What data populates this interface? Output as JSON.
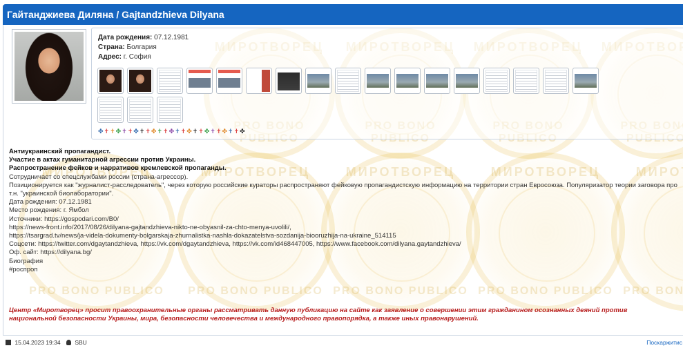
{
  "header": {
    "title": "Гайтанджиева Диляна / Gajtandzhieva Dilyana"
  },
  "profile": {
    "birth_label": "Дата рождения:",
    "birth_value": "07.12.1981",
    "country_label": "Страна:",
    "country_value": "Болгария",
    "address_label": "Адрес:",
    "address_value": "г. София"
  },
  "watermark": {
    "top_text": "МИРОТВОРЕЦ",
    "bottom_text": "PRO BONO PUBLICO"
  },
  "thumbnails": [
    "photo",
    "photo",
    "doc",
    "web",
    "web",
    "news",
    "dark",
    "land",
    "doc",
    "land",
    "land",
    "land",
    "land",
    "doc",
    "doc",
    "doc",
    "land",
    "doc",
    "doc",
    "doc"
  ],
  "flags_colors": [
    "#3a6fb0",
    "#d93b3b",
    "#e08a2b",
    "#3aa04a",
    "#8b4aa8",
    "#d93b3b",
    "#3a6fb0",
    "#2b2b2b",
    "#d93b3b",
    "#e08a2b",
    "#3aa04a",
    "#d93b3b",
    "#8b4aa8",
    "#3a6fb0",
    "#d93b3b",
    "#e08a2b",
    "#2b2b2b",
    "#d93b3b",
    "#3aa04a",
    "#8b4aa8",
    "#d93b3b",
    "#e08a2b",
    "#3a6fb0",
    "#d93b3b",
    "#2b2b2b"
  ],
  "description": {
    "line1": "Антиукраинский пропагандист.",
    "line2": "Участие в актах гуманитарной агрессии против Украины.",
    "line3": "Распространение фейков и нарративов кремлевской пропаганды.",
    "line4": "Сотрудничает со спецслужбами россии (страна-агрессор).",
    "line5": "Позиционируется как \"журналист-расследователь\", через которую российские кураторы распространяют фейковую пропагандистскую информацию на территории стран Евросоюза. Популяризатор теории заговора про т.н. \"украинской биолаборатории\".",
    "line6": "Дата рождения: 07.12.1981",
    "line7": "Место рождения: г. Ямбол",
    "line8": "Источники: https://gospodari.com/B0/",
    "line9": "https://news-front.info/2017/08/26/dilyana-gajtandzhieva-nikto-ne-obyasnil-za-chto-menya-uvolili/,",
    "line10": "https://tsargrad.tv/news/ja-videla-dokumenty-bolgarskaja-zhurnalistka-nashla-dokazatelstva-sozdanija-biooruzhija-na-ukraine_514115",
    "line11": "Соцсети: https://twitter.com/dgaytandzhieva, https://vk.com/dgaytandzhieva, https://vk.com/id468447005, https://www.facebook.com/dilyana.gaytandzhieva/",
    "line12": "Оф. сайт: https://dilyana.bg/",
    "line13": "Биография",
    "line14": "#роспроп"
  },
  "notice": "Центр «Миротворец» просит правоохранительные органы рассматривать данную публикацию на сайте как заявление о совершении этим гражданином осознанных деяний против национальной безопасности Украины, мира, безопасности человечества и международного правопорядка, а также иных правонарушений.",
  "footer": {
    "datetime": "15.04.2023 19:34",
    "author": "SBU",
    "right_link": "Поскаржитис"
  }
}
